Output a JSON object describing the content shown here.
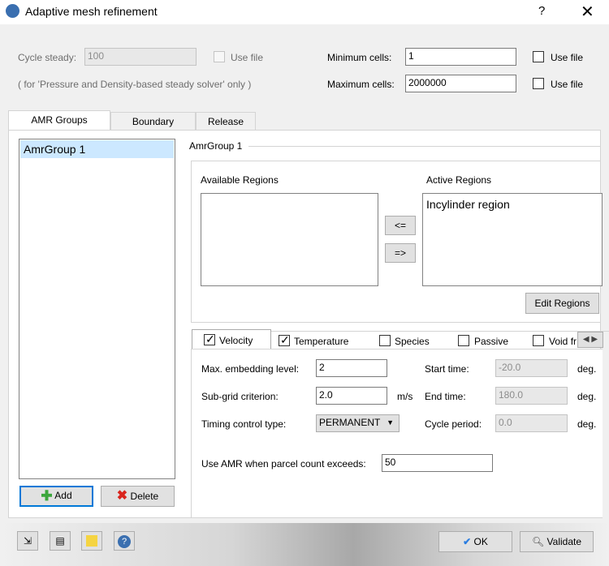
{
  "window": {
    "title": "Adaptive mesh refinement",
    "help_label": "?",
    "close_label": "✕"
  },
  "top": {
    "cycle_steady_label": "Cycle steady:",
    "cycle_steady_value": "100",
    "use_file_label": "Use file",
    "note": "( for 'Pressure and Density-based steady solver' only )",
    "min_cells_label": "Minimum cells:",
    "min_cells_value": "1",
    "max_cells_label": "Maximum cells:",
    "max_cells_value": "2000000"
  },
  "tabs": [
    {
      "label": "AMR Groups"
    },
    {
      "label": "Boundary"
    },
    {
      "label": "Release"
    }
  ],
  "groups": {
    "items": [
      "AmrGroup 1"
    ],
    "add_label": "Add",
    "delete_label": "Delete"
  },
  "group_panel": {
    "title": "AmrGroup 1",
    "available_label": "Available Regions",
    "active_label": "Active Regions",
    "active_items": [
      "Incylinder region"
    ],
    "move_left_label": "<=",
    "move_right_label": "=>",
    "edit_regions_label": "Edit Regions"
  },
  "criteria_tabs": [
    {
      "label": "Velocity",
      "checked": true
    },
    {
      "label": "Temperature",
      "checked": true
    },
    {
      "label": "Species",
      "checked": false
    },
    {
      "label": "Passive",
      "checked": false
    },
    {
      "label": "Void fr",
      "checked": false
    }
  ],
  "velocity": {
    "max_embed_label": "Max. embedding level:",
    "max_embed_value": "2",
    "subgrid_label": "Sub-grid criterion:",
    "subgrid_value": "2.0",
    "subgrid_unit": "m/s",
    "timing_label": "Timing control type:",
    "timing_value": "PERMANENT",
    "start_label": "Start time:",
    "start_value": "-20.0",
    "end_label": "End time:",
    "end_value": "180.0",
    "period_label": "Cycle period:",
    "period_value": "0.0",
    "deg_label": "deg.",
    "parcel_label": "Use AMR when parcel count exceeds:",
    "parcel_value": "50"
  },
  "footer": {
    "ok_label": "OK",
    "validate_label": "Validate"
  }
}
